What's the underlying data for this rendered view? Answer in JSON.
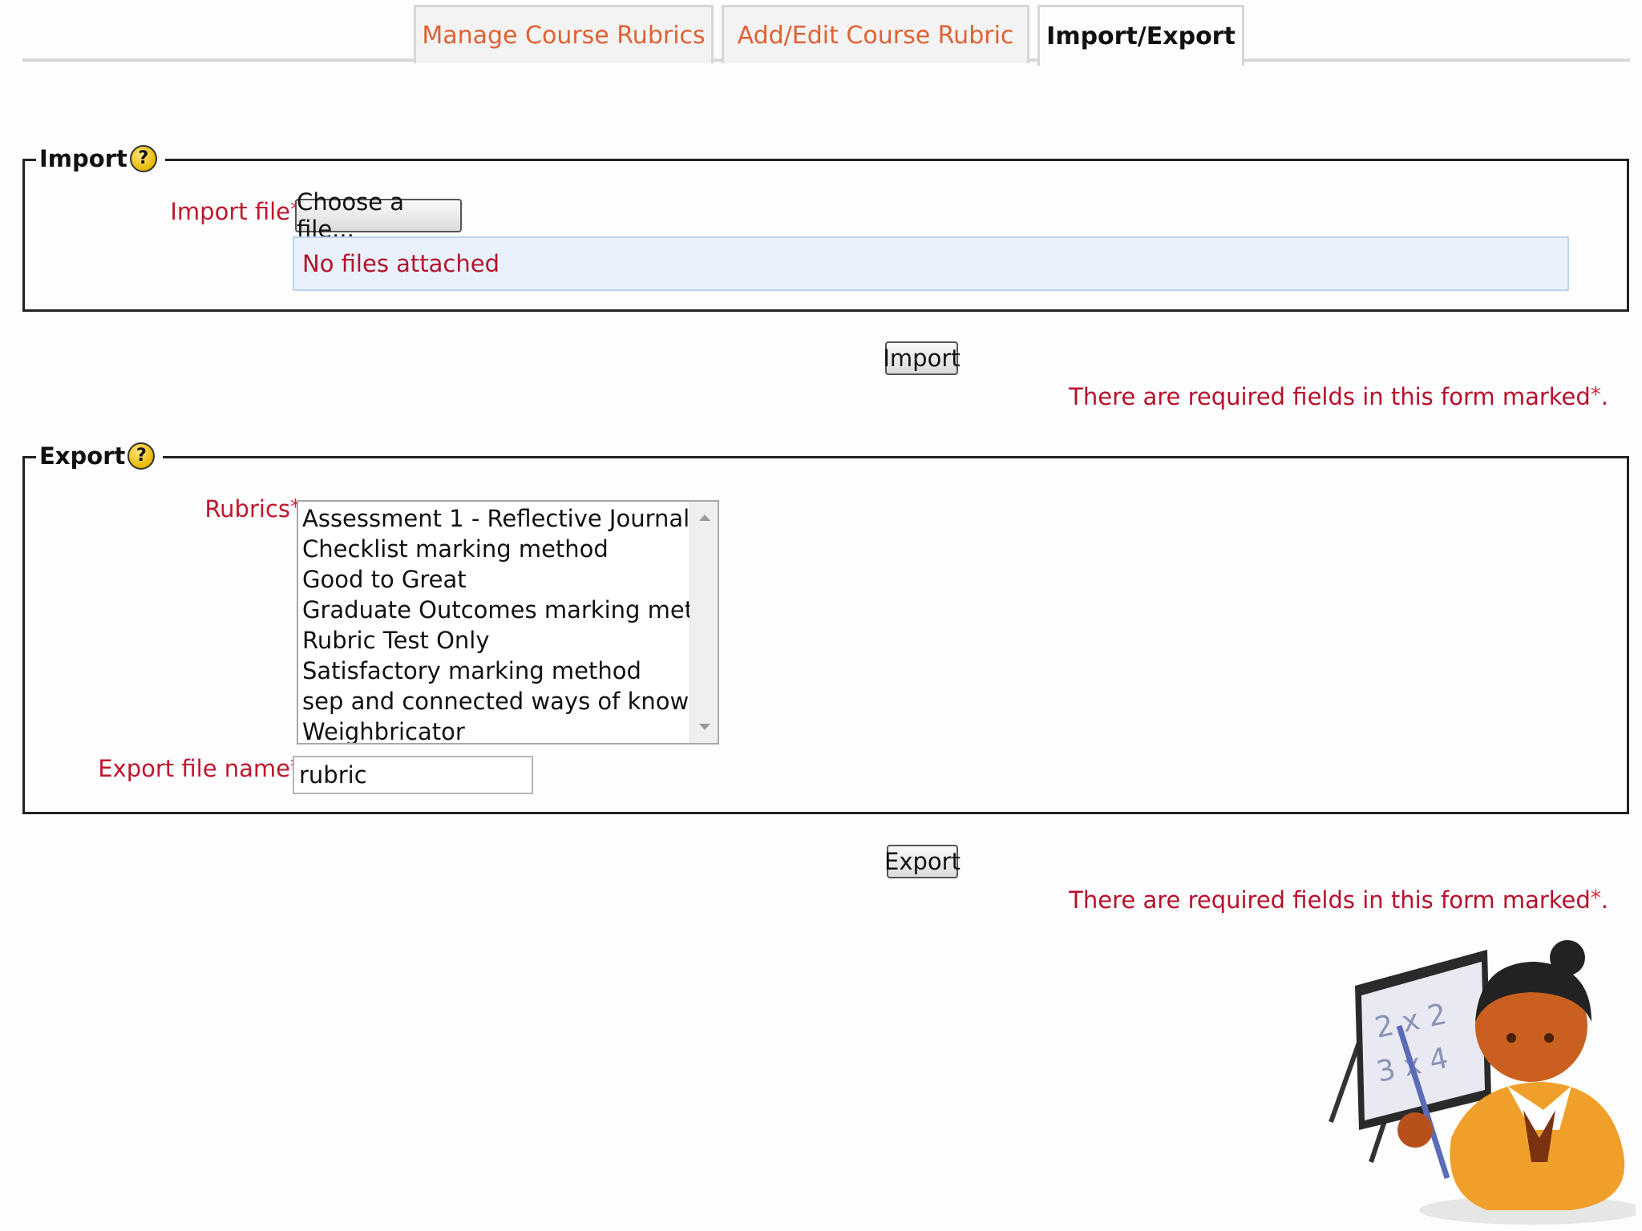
{
  "tabs": [
    {
      "label": "Manage Course Rubrics",
      "active": false
    },
    {
      "label": "Add/Edit Course Rubric",
      "active": false
    },
    {
      "label": "Import/Export",
      "active": true
    }
  ],
  "import_section": {
    "legend": "Import",
    "file_label": "Import file",
    "required_marker": "*",
    "choose_button": "Choose a file...",
    "files_status": "No files attached",
    "submit_button": "Import",
    "required_note": "There are required fields in this form marked"
  },
  "export_section": {
    "legend": "Export",
    "rubrics_label": "Rubrics",
    "required_marker": "*",
    "rubrics_options": [
      "Assessment 1 - Reflective Journal",
      "Checklist marking method",
      "Good to Great",
      "Graduate Outcomes marking method",
      "Rubric Test Only",
      "Satisfactory marking method",
      "sep and connected ways of knowing",
      "Weighbricator"
    ],
    "file_name_label": "Export file name",
    "file_name_value": "rubric",
    "submit_button": "Export",
    "required_note": "There are required fields in this form marked"
  },
  "mascot": {
    "board_line1": "2 x 2",
    "board_line2": "3 x 4"
  },
  "colors": {
    "tab_link": "#e06133",
    "required_red": "#c0162c",
    "files_bg": "#e9f2fc"
  }
}
